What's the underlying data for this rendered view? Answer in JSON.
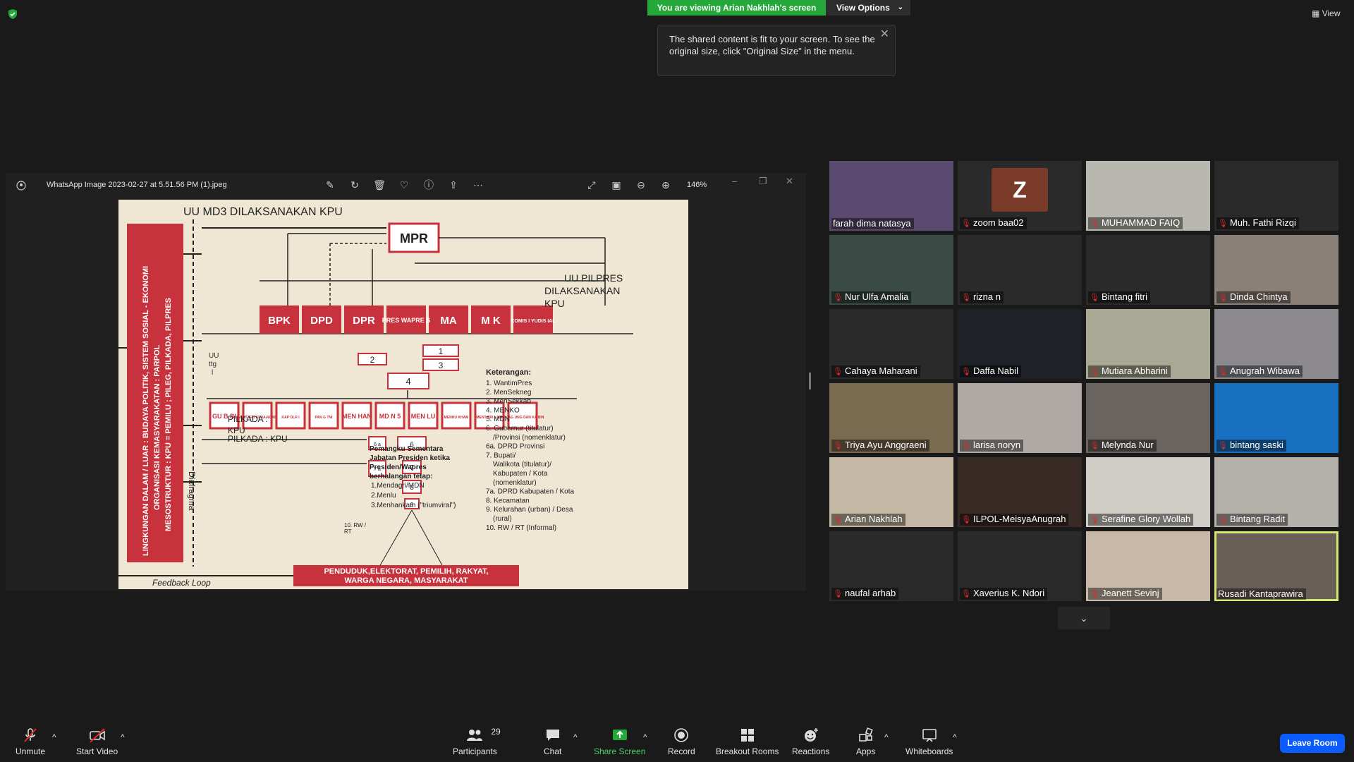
{
  "banner": {
    "viewing": "You are viewing Arian Nakhlah's screen",
    "view_options": "View Options"
  },
  "tooltip": {
    "text": "The shared content is fit to your screen. To see the original size, click \"Original Size\" in the menu."
  },
  "top_right": {
    "view": "View"
  },
  "viewer": {
    "title": "WhatsApp Image 2023-02-27 at 5.51.56 PM (1).jpeg",
    "zoom": "146%"
  },
  "slide": {
    "top_title": "UU MD3 DILAKSANAKAN KPU",
    "mpr": "MPR",
    "side_text_1": "LINGKUNGAN DALAM / LUAR : BUDAYA POLITIK, SISTEM SOSIAL - EKONOMI",
    "side_text_2": "ORGANISASI KEMASYARAKATAN : PARPOL",
    "side_text_3": "MESOSTRUKTUR : KPU = PEMILU ; PILEG, PILKADA, PILPRES",
    "institutions": [
      "BPK",
      "DPD",
      "DPR",
      "PRES WAPRE S",
      "MA",
      "M K",
      "KOMIS I YUDIS IAL"
    ],
    "uu_pilpres": [
      "UU PILPRES",
      "DILAKSANAKAN",
      "KPU"
    ],
    "numbers": [
      "1",
      "2",
      "3",
      "4",
      "6",
      "7",
      "8",
      "9"
    ],
    "uu_ttg": [
      "UU",
      "ttg",
      "l"
    ],
    "ministries": [
      "GU B BI",
      "MENT ERI KEUA NGAN",
      "KAP OLR I",
      "PAN G TNI",
      "MEN HAN",
      "MD N 5",
      "MEN LU",
      "MENHU KHAM",
      "MENT ERI LAIN",
      "KAJAG UNG DAN KA BIN"
    ],
    "pilkada_1": "PILKADA :",
    "kpu_1": "KPU",
    "pilkada_2": "PILKADA : KPU",
    "six_a": "6 a",
    "seven_a": "7 a",
    "diafragma": "Diafragma",
    "keterangan_title": "Keterangan:",
    "keterangan": [
      "1. WantimPres",
      "2. MenSekneg",
      "3. MenSekkab",
      "4. MENKO",
      "5. MDN",
      "6. Gubernur (titulatur)",
      "/Provinsi  (nomenklatur)",
      "6a. DPRD Provinsi",
      "7. Bupati/",
      "Walikota (titulatur)/",
      "Kabupaten / Kota",
      "(nomenklatur)",
      "7a. DPRD Kabupaten / Kota",
      "8. Kecamatan",
      "9. Kelurahan (urban) / Desa",
      "(rural)",
      "10. RW / RT (Informal)"
    ],
    "pemangku": [
      "Pemangku Sementara",
      "Jabatan  Presiden ketika",
      "Presiden/Wapres",
      "berhalangan tetap:"
    ],
    "pemangku_list": [
      "1.Mendagri/MDN",
      "2.Menlu",
      "3.Menhankam (\"triumviral\")"
    ],
    "ten_rw": [
      "10. RW /",
      "RT"
    ],
    "penduduk": [
      "PENDUDUK,ELEKTORAT, PEMILIH, RAKYAT,",
      "WARGA NEGARA, MASYARAKAT"
    ],
    "feedback": "Feedback Loop"
  },
  "participants": [
    {
      "name": "farah dima natasya",
      "muted": false,
      "bg": "#5a4a70"
    },
    {
      "name": "zoom baa02",
      "muted": true,
      "bg": "#2a2a2a",
      "avatar": "Z"
    },
    {
      "name": "MUHAMMAD FAIQ",
      "muted": true,
      "bg": "#b8b8b0"
    },
    {
      "name": "Muh. Fathi Rizqi",
      "muted": true,
      "bg": "#2a2a2a"
    },
    {
      "name": "Nur Ulfa Amalia",
      "muted": true,
      "bg": "#3a4a44"
    },
    {
      "name": "rizna n",
      "muted": true,
      "bg": "#2a2a2a"
    },
    {
      "name": "Bintang fitri",
      "muted": true,
      "bg": "#2a2a2a"
    },
    {
      "name": "Dinda Chintya",
      "muted": true,
      "bg": "#8a8078"
    },
    {
      "name": "Cahaya Maharani",
      "muted": true,
      "bg": "#2a2a2a"
    },
    {
      "name": "Daffa Nabil",
      "muted": true,
      "bg": "#1e2228"
    },
    {
      "name": "Mutiara Abharini",
      "muted": true,
      "bg": "#a8a894"
    },
    {
      "name": "Anugrah Wibawa",
      "muted": true,
      "bg": "#8c8a8e"
    },
    {
      "name": "Triya Ayu Anggraeni",
      "muted": true,
      "bg": "#7a6a50"
    },
    {
      "name": "larisa noryn",
      "muted": true,
      "bg": "#b0a8a4"
    },
    {
      "name": "Melynda Nur",
      "muted": true,
      "bg": "#6a6460"
    },
    {
      "name": "bintang saski",
      "muted": true,
      "bg": "#1a70c0"
    },
    {
      "name": "Arian Nakhlah",
      "muted": true,
      "bg": "#c4b8a4"
    },
    {
      "name": "ILPOL-MeisyaAnugrah",
      "muted": true,
      "bg": "#3a2a26"
    },
    {
      "name": "Serafine Glory Wollah",
      "muted": true,
      "bg": "#d0ccc6"
    },
    {
      "name": "Bintang Radit",
      "muted": true,
      "bg": "#b4b0aa"
    },
    {
      "name": "naufal arhab",
      "muted": true,
      "bg": "#2a2a2a"
    },
    {
      "name": "Xaverius K. Ndori",
      "muted": true,
      "bg": "#2a2a2a"
    },
    {
      "name": "Jeanett Sevinj",
      "muted": true,
      "bg": "#c8b8a8"
    },
    {
      "name": "Rusadi Kantaprawira",
      "muted": false,
      "bg": "#6a5e58",
      "active": true
    }
  ],
  "toolbar": {
    "unmute": "Unmute",
    "start_video": "Start Video",
    "participants": "Participants",
    "participants_count": "29",
    "chat": "Chat",
    "share_screen": "Share Screen",
    "record": "Record",
    "breakout_rooms": "Breakout Rooms",
    "reactions": "Reactions",
    "apps": "Apps",
    "whiteboards": "Whiteboards",
    "leave_room": "Leave Room"
  },
  "colors": {
    "green": "#23a839",
    "blue": "#0b5cff",
    "red": "#c8323c",
    "active_outline": "#d6e874"
  }
}
